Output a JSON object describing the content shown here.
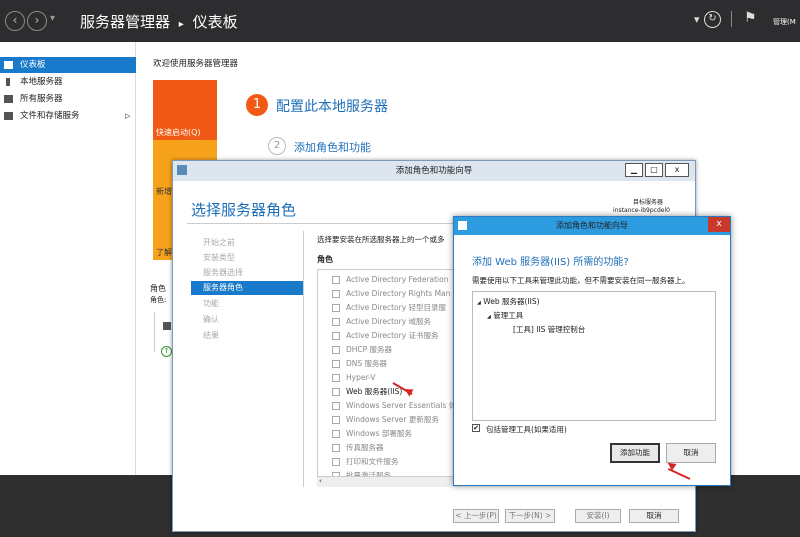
{
  "topbar": {
    "app": "服务器管理器",
    "separator": "▸",
    "page": "仪表板",
    "user_truncated": "管理(M",
    "refresh_icon": "refresh-icon",
    "flag_icon": "flag-icon"
  },
  "leftnav": {
    "items": [
      {
        "label": "仪表板",
        "icon": "dashboard-icon",
        "selected": true
      },
      {
        "label": "本地服务器",
        "icon": "server-icon"
      },
      {
        "label": "所有服务器",
        "icon": "servers-icon"
      },
      {
        "label": "文件和存储服务",
        "icon": "storage-icon",
        "has_arrow": true
      }
    ]
  },
  "dashboard": {
    "welcome": "欢迎使用服务器管理器",
    "quickstart": "快速启动(Q)",
    "new_truncated": "新增",
    "learn_truncated": "了解",
    "step1_num": "1",
    "step1": "配置此本地服务器",
    "step2_num": "2",
    "step2": "添加角色和功能",
    "roles_label": "角色",
    "roles_sub": "角色:"
  },
  "wizard": {
    "title": "添加角色和功能向导",
    "minimize": "▁",
    "maximize": "□",
    "close": "x",
    "heading": "选择服务器角色",
    "target_label": "目标服务器",
    "target_value": "instance-ib9pcdel0",
    "steps": [
      {
        "label": "开始之前",
        "active": false
      },
      {
        "label": "安装类型",
        "active": false
      },
      {
        "label": "服务器选择",
        "active": false
      },
      {
        "label": "服务器角色",
        "active": true
      },
      {
        "label": "功能",
        "active": false
      },
      {
        "label": "确认",
        "active": false
      },
      {
        "label": "结果",
        "active": false
      }
    ],
    "description": "选择要安装在所选服务器上的一个或多",
    "roles_header": "角色",
    "roles": [
      {
        "label": "Active Directory Federation"
      },
      {
        "label": "Active Directory Rights Man"
      },
      {
        "label": "Active Directory 轻型目录服"
      },
      {
        "label": "Active Directory 域服务"
      },
      {
        "label": "Active Directory 证书服务"
      },
      {
        "label": "DHCP 服务器"
      },
      {
        "label": "DNS 服务器"
      },
      {
        "label": "Hyper-V"
      },
      {
        "label": "Web 服务器(IIS)",
        "enabled": true
      },
      {
        "label": "Windows Server Essentials 体"
      },
      {
        "label": "Windows Server 更新服务"
      },
      {
        "label": "Windows 部署服务"
      },
      {
        "label": "传真服务器"
      },
      {
        "label": "打印和文件服务"
      },
      {
        "label": "批量激活服务"
      }
    ],
    "buttons": {
      "prev": "< 上一步(P)",
      "next": "下一步(N) >",
      "install": "安装(I)",
      "cancel": "取消"
    }
  },
  "dialog": {
    "title": "添加角色和功能向导",
    "close": "x",
    "heading": "添加 Web 服务器(IIS) 所需的功能?",
    "description": "需要使用以下工具来管理此功能，但不需要安装在同一服务器上。",
    "tree": [
      {
        "label": "Web 服务器(IIS)",
        "level": 0,
        "expander": "◢"
      },
      {
        "label": "管理工具",
        "level": 1,
        "expander": "◢"
      },
      {
        "label": "[工具] IIS 管理控制台",
        "level": 2
      }
    ],
    "include_checked": "✔",
    "include_label": "包括管理工具(如果适用)",
    "add_button": "添加功能",
    "cancel_button": "取消"
  }
}
